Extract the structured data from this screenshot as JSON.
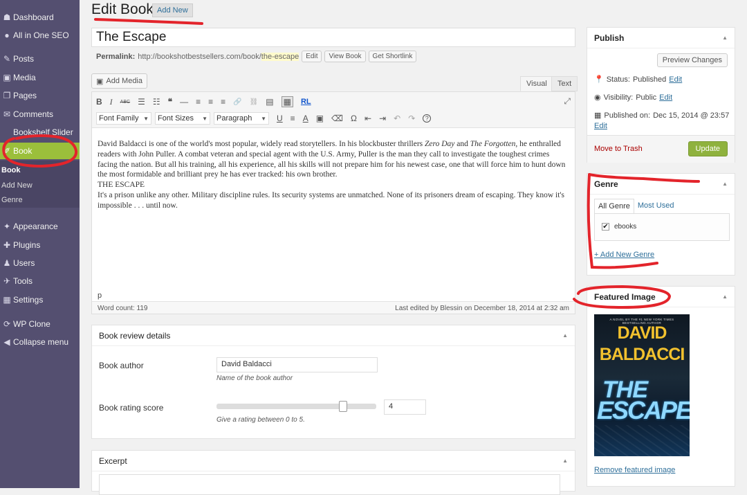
{
  "sidebar": {
    "items": [
      {
        "label": "Dashboard",
        "icon": "dashboard-icon",
        "glyph": "☗"
      },
      {
        "label": "All in One SEO",
        "icon": "seo-icon",
        "glyph": "●"
      },
      {
        "label": "Posts",
        "icon": "pin-icon",
        "glyph": "✎"
      },
      {
        "label": "Media",
        "icon": "media-icon",
        "glyph": "▣"
      },
      {
        "label": "Pages",
        "icon": "pages-icon",
        "glyph": "❐"
      },
      {
        "label": "Comments",
        "icon": "comments-icon",
        "glyph": "✉"
      },
      {
        "label": "Bookshelf Slider",
        "icon": "",
        "glyph": ""
      },
      {
        "label": "Book",
        "icon": "book-icon",
        "glyph": "✐"
      },
      {
        "label": "Appearance",
        "icon": "appearance-icon",
        "glyph": "✦"
      },
      {
        "label": "Plugins",
        "icon": "plugins-icon",
        "glyph": "✚"
      },
      {
        "label": "Users",
        "icon": "users-icon",
        "glyph": "♟"
      },
      {
        "label": "Tools",
        "icon": "tools-icon",
        "glyph": "✈"
      },
      {
        "label": "Settings",
        "icon": "settings-icon",
        "glyph": "▦"
      },
      {
        "label": "WP Clone",
        "icon": "wpclone-icon",
        "glyph": "⟳"
      },
      {
        "label": "Collapse menu",
        "icon": "collapse-icon",
        "glyph": "◀"
      }
    ],
    "submenu": [
      "Book",
      "Add New",
      "Genre"
    ]
  },
  "header": {
    "title": "Edit Book",
    "add_new": "Add New"
  },
  "post": {
    "title": "The Escape",
    "permalink_label": "Permalink:",
    "permalink_base": "http://bookshotbestsellers.com/book/",
    "permalink_slug": "the-escape",
    "buttons": [
      "Edit",
      "View Book",
      "Get Shortlink"
    ]
  },
  "editor": {
    "add_media": "Add Media",
    "tabs": {
      "visual": "Visual",
      "text": "Text"
    },
    "toolbar_row1": [
      "B",
      "I",
      "ABC",
      "☰",
      "☷",
      "❝",
      "—",
      "≡",
      "≡",
      "≡",
      "🔗",
      "⛓",
      "▤",
      "▦"
    ],
    "rl": "RL",
    "dropdowns": {
      "font_family": "Font Family",
      "font_sizes": "Font Sizes",
      "format": "Paragraph"
    },
    "toolbar_row2": [
      "U",
      "≡",
      "A",
      "▣",
      "⌫",
      "Ω",
      "⇤",
      "⇥",
      "↶",
      "↷",
      "?"
    ],
    "content": {
      "p1_a": "David Baldacci is one of the world's most popular, widely read storytellers. In his blockbuster thrillers ",
      "p1_em1": "Zero Day",
      "p1_b": " and ",
      "p1_em2": "The Forgotten",
      "p1_c": ", he enthralled readers with John Puller. A combat veteran and special agent with the U.S. Army, Puller is the man they call to investigate the toughest crimes facing the nation. But all his training, all his experience, all his skills will not prepare him for his newest case, one that will force him to hunt down the most formidable and brilliant prey he has ever tracked: his own brother.",
      "p2": "THE ESCAPE",
      "p3": "It's a prison unlike any other. Military discipline rules. Its security systems are unmatched. None of its prisoners dream of escaping. They know it's impossible . . . until now."
    },
    "path": "p",
    "word_count": "Word count: 119",
    "last_edited": "Last edited by Blessin on December 18, 2014 at 2:32 am"
  },
  "review": {
    "title": "Book review details",
    "author_label": "Book author",
    "author_value": "David Baldacci",
    "author_hint": "Name of the book author",
    "rating_label": "Book rating score",
    "rating_value": "4",
    "rating_fraction": 0.8,
    "rating_hint": "Give a rating between 0 to 5."
  },
  "excerpt": {
    "title": "Excerpt"
  },
  "publish": {
    "title": "Publish",
    "preview": "Preview Changes",
    "status_label": "Status:",
    "status_value": "Published",
    "visibility_label": "Visibility:",
    "visibility_value": "Public",
    "published_label": "Published on:",
    "published_value": "Dec 15, 2014 @ 23:57",
    "edit": "Edit",
    "trash": "Move to Trash",
    "update": "Update"
  },
  "genre": {
    "title": "Genre",
    "tab_all": "All Genre",
    "tab_used": "Most Used",
    "item": "ebooks",
    "add": "+ Add New Genre"
  },
  "featured": {
    "title": "Featured Image",
    "cover_tag": "A NOVEL BY THE #1 NEW YORK TIMES BESTSELLING AUTHOR",
    "cover_author_1": "DAVID",
    "cover_author_2": "BALDACCI",
    "cover_title_1": "THE",
    "cover_title_2": "ESCAPE",
    "remove": "Remove featured image"
  },
  "colors": {
    "sidebar": "#544f70",
    "active": "#9bbf3b",
    "link": "#2e6f9a",
    "annotation": "#e3242b"
  }
}
